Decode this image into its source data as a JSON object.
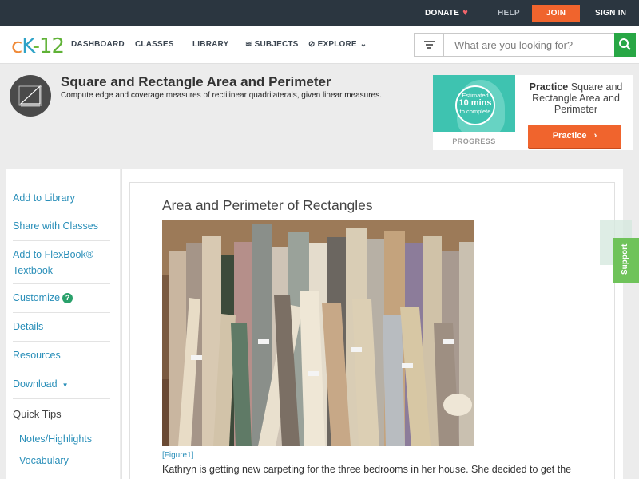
{
  "topbar": {
    "donate": "DONATE",
    "help": "HELP",
    "join": "JOIN",
    "signin": "SIGN IN"
  },
  "nav": {
    "logo": {
      "c": "c",
      "k": "K",
      "dash": "-",
      "num": "12"
    },
    "items": [
      "DASHBOARD",
      "CLASSES",
      "LIBRARY",
      "SUBJECTS",
      "EXPLORE"
    ],
    "search_placeholder": "What are you looking for?"
  },
  "header": {
    "title": "Square and Rectangle Area and Perimeter",
    "subtitle": "Compute edge and coverage measures of rectilinear quadrilaterals, given linear measures."
  },
  "practice": {
    "estimated_line1": "Estimated",
    "estimated_line2": "10 mins",
    "estimated_line3": "to complete",
    "progress_label": "PROGRESS",
    "title_bold": "Practice",
    "title_rest": "Square and Rectangle Area and Perimeter",
    "button": "Practice"
  },
  "sidebar": {
    "links": [
      "Add to Library",
      "Share with Classes",
      "Add to FlexBook® Textbook",
      "Customize",
      "Details",
      "Resources",
      "Download"
    ],
    "customize_badge": "?",
    "quick_tips": "Quick Tips",
    "tips": [
      "Notes/Highlights",
      "Vocabulary"
    ]
  },
  "article": {
    "title": "Area and Perimeter of Rectangles",
    "caption": "[Figure1]",
    "body": "Kathryn is getting new carpeting for the three bedrooms in her house. She decided to get the"
  },
  "support": "Support",
  "colors": {
    "topbar": "#2b3640",
    "accent_orange": "#f0642d",
    "link_blue": "#2a8fb9",
    "search_green": "#28a745",
    "support_green": "#6fc35a"
  }
}
